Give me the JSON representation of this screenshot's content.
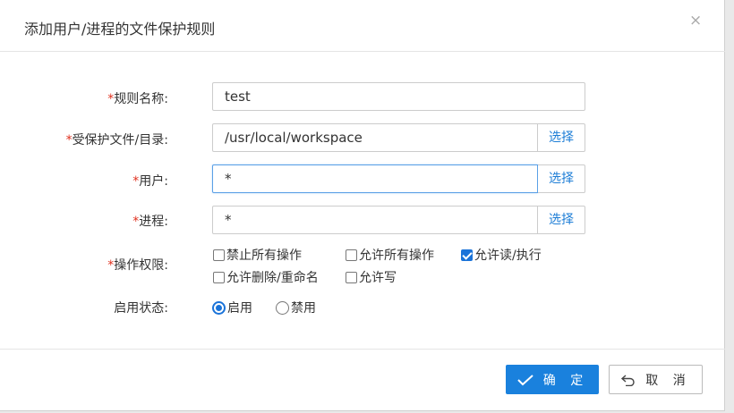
{
  "dialog": {
    "title": "添加用户/进程的文件保护规则",
    "close_glyph": "×"
  },
  "form": {
    "required_mark": "*",
    "rule_name": {
      "label": "规则名称:",
      "value": "test"
    },
    "protected_path": {
      "label": "受保护文件/目录:",
      "value": "/usr/local/workspace",
      "pick_label": "选择"
    },
    "user": {
      "label": "用户:",
      "value": "*",
      "pick_label": "选择"
    },
    "process": {
      "label": "进程:",
      "value": "*",
      "pick_label": "选择"
    },
    "permissions": {
      "label": "操作权限:",
      "options": [
        {
          "label": "禁止所有操作",
          "checked": false
        },
        {
          "label": "允许所有操作",
          "checked": false
        },
        {
          "label": "允许读/执行",
          "checked": true
        },
        {
          "label": "允许删除/重命名",
          "checked": false
        },
        {
          "label": "允许写",
          "checked": false
        }
      ]
    },
    "status": {
      "label": "启用状态:",
      "options": [
        {
          "label": "启用",
          "selected": true
        },
        {
          "label": "禁用",
          "selected": false
        }
      ]
    }
  },
  "footer": {
    "ok_label": "确 定",
    "cancel_label": "取 消"
  },
  "colors": {
    "accent": "#1a81dd",
    "link": "#1e7ed6",
    "required": "#e0301e"
  },
  "icons": {
    "ok": "check-icon",
    "cancel": "undo-icon",
    "close": "close-icon"
  }
}
